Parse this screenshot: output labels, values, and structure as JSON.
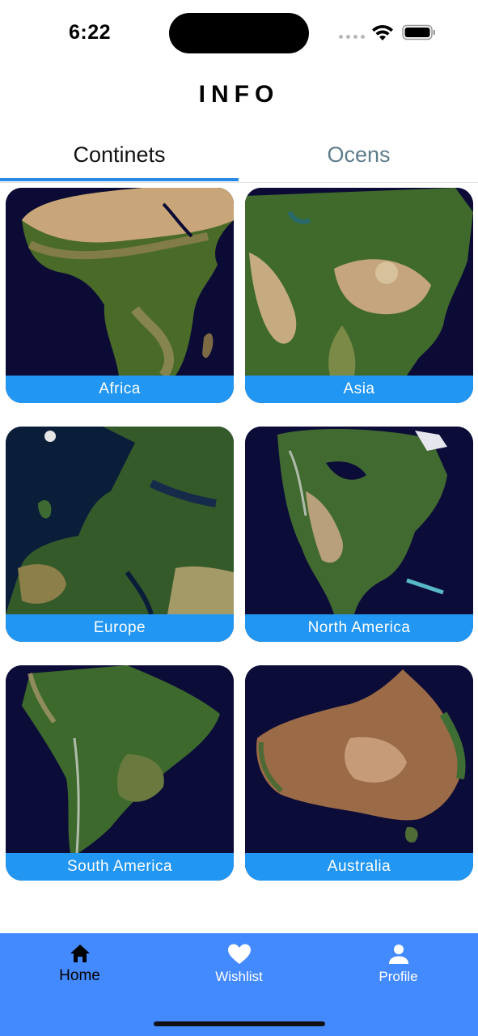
{
  "status_bar": {
    "time": "6:22"
  },
  "header": {
    "title": "INFO"
  },
  "tabs": [
    {
      "label": "Continets",
      "selected": true
    },
    {
      "label": "Ocens",
      "selected": false
    }
  ],
  "continents": [
    {
      "name": "Africa"
    },
    {
      "name": "Asia"
    },
    {
      "name": "Europe"
    },
    {
      "name": "North America"
    },
    {
      "name": "South America"
    },
    {
      "name": "Australia"
    }
  ],
  "bottom_nav": {
    "items": [
      {
        "label": "Home",
        "icon": "home-icon",
        "active": true
      },
      {
        "label": "Wishlist",
        "icon": "heart-icon",
        "active": false
      },
      {
        "label": "Profile",
        "icon": "person-icon",
        "active": false
      }
    ]
  },
  "colors": {
    "accent": "#2a8be6",
    "card_label_bg": "#2196f3",
    "nav_bg": "#448aff",
    "ocean": "#0c0c38"
  }
}
